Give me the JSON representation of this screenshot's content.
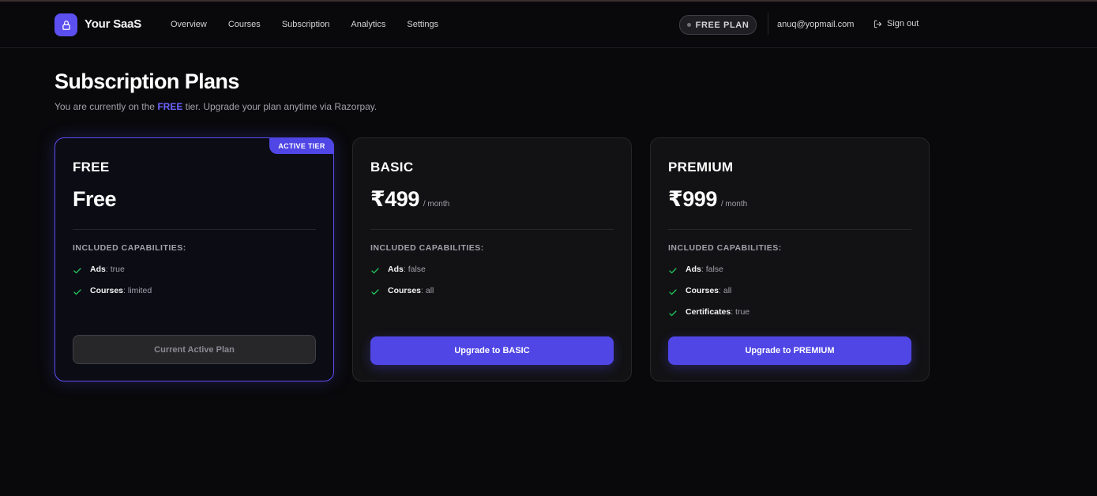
{
  "header": {
    "brand": "Your SaaS",
    "nav": [
      "Overview",
      "Courses",
      "Subscription",
      "Analytics",
      "Settings"
    ],
    "plan_badge": "FREE PLAN",
    "email": "anuq@yopmail.com",
    "sign_out": "Sign out"
  },
  "page": {
    "title": "Subscription Plans",
    "subtitle_prefix": "You are currently on the ",
    "current_tier": "FREE",
    "subtitle_suffix": " tier. Upgrade your plan anytime via Razorpay."
  },
  "plans": [
    {
      "name": "FREE",
      "price": "Free",
      "period": "",
      "active": true,
      "badge": "ACTIVE TIER",
      "capabilities_title": "INCLUDED CAPABILITIES:",
      "capabilities": [
        {
          "key": "Ads",
          "value": "true"
        },
        {
          "key": "Courses",
          "value": "limited"
        }
      ],
      "button": "Current Active Plan"
    },
    {
      "name": "BASIC",
      "price": "₹499",
      "period": "/ month",
      "active": false,
      "capabilities_title": "INCLUDED CAPABILITIES:",
      "capabilities": [
        {
          "key": "Ads",
          "value": "false"
        },
        {
          "key": "Courses",
          "value": "all"
        }
      ],
      "button": "Upgrade to BASIC"
    },
    {
      "name": "PREMIUM",
      "price": "₹999",
      "period": "/ month",
      "active": false,
      "capabilities_title": "INCLUDED CAPABILITIES:",
      "capabilities": [
        {
          "key": "Ads",
          "value": "false"
        },
        {
          "key": "Courses",
          "value": "all"
        },
        {
          "key": "Certificates",
          "value": "true"
        }
      ],
      "button": "Upgrade to PREMIUM"
    }
  ],
  "colors": {
    "accent": "#4f46e5",
    "background": "#09090b",
    "check": "#22c55e"
  },
  "icons": {
    "logo": "lock-icon",
    "sign_out": "sign-out-icon",
    "capability": "check-icon"
  }
}
